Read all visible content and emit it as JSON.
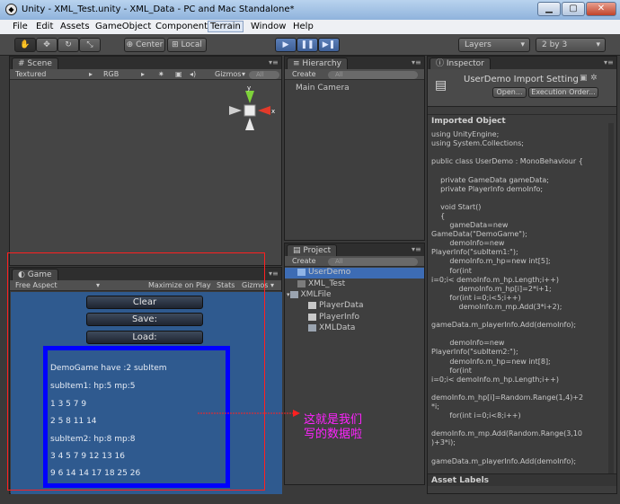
{
  "window": {
    "title": "Unity - XML_Test.unity - XML_Data - PC and Mac Standalone*",
    "icon": "unity-icon",
    "controls": [
      "minimize",
      "maximize",
      "close"
    ]
  },
  "menubar": [
    "File",
    "Edit",
    "Assets",
    "GameObject",
    "Component",
    "Terrain",
    "Window",
    "Help"
  ],
  "toolbar": {
    "pivot_label": "Center",
    "space_label": "Local",
    "layers_label": "Layers",
    "layout_label": "2 by 3"
  },
  "scene": {
    "tab": "Scene",
    "shading": "Textured",
    "render": "RGB",
    "gizmos": "Gizmos",
    "search_placeholder": "All"
  },
  "game": {
    "tab": "Game",
    "aspect": "Free Aspect",
    "maximize": "Maximize on Play",
    "stats": "Stats",
    "gizmos": "Gizmos",
    "buttons": [
      "Clear",
      "Save:",
      "Load:"
    ],
    "lines": [
      "DemoGame  have :2 subItem",
      "subItem1:  hp:5 mp:5",
      "1 3 5 7 9",
      "2 5 8 11 14",
      "subItem2:  hp:8 mp:8",
      "3 4 5 7 9 12 13 16",
      "9 6 14 14 17 18 25 26"
    ]
  },
  "hierarchy": {
    "tab": "Hierarchy",
    "create": "Create",
    "search_placeholder": "All",
    "items": [
      "Main Camera"
    ]
  },
  "project": {
    "tab": "Project",
    "create": "Create",
    "search_placeholder": "All",
    "items": [
      {
        "label": "UserDemo",
        "kind": "script",
        "selected": true
      },
      {
        "label": "XML_Test",
        "kind": "scene"
      },
      {
        "label": "XMLFile",
        "kind": "folder"
      },
      {
        "label": "PlayerData",
        "kind": "script"
      },
      {
        "label": "PlayerInfo",
        "kind": "script"
      },
      {
        "label": "XMLData",
        "kind": "folder"
      }
    ]
  },
  "inspector": {
    "tab": "Inspector",
    "header": "UserDemo Import Setting",
    "open_button": "Open...",
    "order_button": "Execution Order...",
    "section": "Imported Object",
    "asset_labels": "Asset Labels",
    "code": [
      "using UnityEngine;",
      "using System.Collections;",
      "",
      "public class UserDemo : MonoBehaviour {",
      "",
      "    private GameData gameData;",
      "    private PlayerInfo demoInfo;",
      "",
      "    void Start()",
      "    {",
      "        gameData=new",
      "GameData(\"DemoGame\");",
      "        demoInfo=new",
      "PlayerInfo(\"subItem1:\");",
      "        demoInfo.m_hp=new int[5];",
      "        for(int",
      "i=0;i< demoInfo.m_hp.Length;i++)",
      "            demoInfo.m_hp[i]=2*i+1;",
      "        for(int i=0;i<5;i++)",
      "            demoInfo.m_mp.Add(3*i+2);",
      "",
      "gameData.m_playerInfo.Add(demoInfo);",
      "",
      "        demoInfo=new",
      "PlayerInfo(\"subItem2:\");",
      "        demoInfo.m_hp=new int[8];",
      "        for(int",
      "i=0;i< demoInfo.m_hp.Length;i++)",
      "",
      "demoInfo.m_hp[i]=Random.Range(1,4)+2",
      "*i;",
      "        for(int i=0;i<8;i++)",
      "",
      "demoInfo.m_mp.Add(Random.Range(3,10",
      ")+3*i);",
      "",
      "gameData.m_playerInfo.Add(demoInfo);"
    ]
  },
  "annotation": {
    "line1": "这就是我们",
    "line2": "写的数据啦",
    "color": "#ff22ff"
  },
  "colors": {
    "game_bg": "#2f5a8f",
    "box_border": "#0000ff",
    "highlight_border": "#ff2020"
  }
}
